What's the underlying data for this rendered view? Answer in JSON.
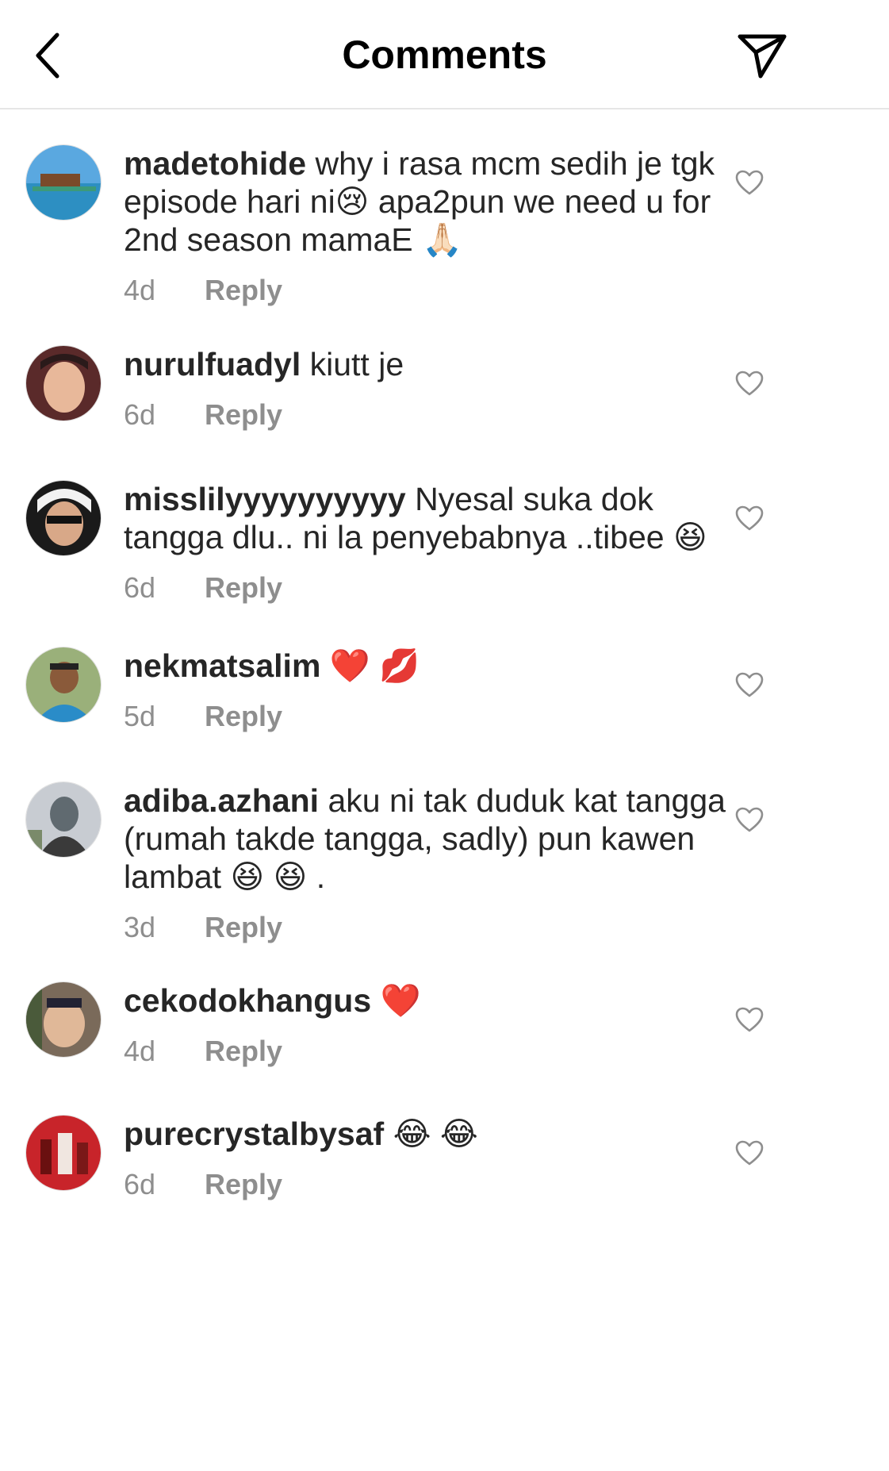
{
  "header": {
    "title": "Comments",
    "back_icon": "chevron-left-icon",
    "send_icon": "paper-plane-icon"
  },
  "comments": [
    {
      "username": "madetohide",
      "text": "why i rasa mcm sedih je tgk episode hari ni😢 apa2pun we need u for 2nd season mamaE 🙏🏻",
      "time": "4d",
      "reply_label": "Reply"
    },
    {
      "username": "nurulfuadyl",
      "text": "kiutt je",
      "time": "6d",
      "reply_label": "Reply"
    },
    {
      "username": "misslilyyyyyyyyyy",
      "text": "Nyesal suka dok tangga dlu.. ni la penyebabnya ..tibee 😆",
      "time": "6d",
      "reply_label": "Reply"
    },
    {
      "username": "nekmatsalim",
      "text": "❤️ 💋",
      "time": "5d",
      "reply_label": "Reply"
    },
    {
      "username": "adiba.azhani",
      "text": "aku ni tak duduk kat tangga (rumah takde tangga, sadly) pun kawen lambat 😆 😆 .",
      "time": "3d",
      "reply_label": "Reply"
    },
    {
      "username": "cekodokhangus",
      "text": "❤️",
      "time": "4d",
      "reply_label": "Reply"
    },
    {
      "username": "purecrystalbysaf",
      "text": "😂 😂",
      "time": "6d",
      "reply_label": "Reply"
    }
  ],
  "colors": {
    "text": "#262626",
    "muted": "#8e8e8e",
    "divider": "#e6e6e6"
  }
}
